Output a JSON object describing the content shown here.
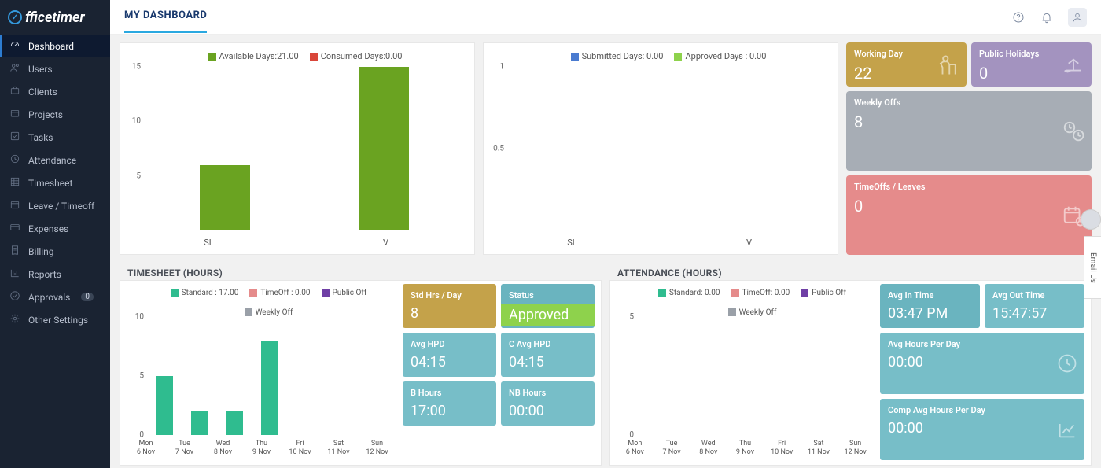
{
  "logo": "fficetimer",
  "page_title": "MY DASHBOARD",
  "sidebar": {
    "items": [
      {
        "icon": "gauge",
        "label": "Dashboard"
      },
      {
        "icon": "users",
        "label": "Users"
      },
      {
        "icon": "briefcase",
        "label": "Clients"
      },
      {
        "icon": "box",
        "label": "Projects"
      },
      {
        "icon": "check-sq",
        "label": "Tasks"
      },
      {
        "icon": "clock",
        "label": "Attendance"
      },
      {
        "icon": "grid",
        "label": "Timesheet"
      },
      {
        "icon": "calendar",
        "label": "Leave / Timeoff"
      },
      {
        "icon": "card",
        "label": "Expenses"
      },
      {
        "icon": "receipt",
        "label": "Billing"
      },
      {
        "icon": "chart",
        "label": "Reports"
      },
      {
        "icon": "check-circle",
        "label": "Approvals",
        "badge": "0"
      },
      {
        "icon": "gear",
        "label": "Other Settings"
      }
    ]
  },
  "chart_data": [
    {
      "type": "bar",
      "title": "",
      "series": [
        {
          "name": "Available Days:21.00",
          "color": "#6aa321"
        },
        {
          "name": "Consumed Days:0.00",
          "color": "#d9463a"
        }
      ],
      "categories": [
        "SL",
        "V"
      ],
      "values": {
        "Available": [
          6,
          15
        ],
        "Consumed": [
          0,
          0
        ]
      },
      "ylim": [
        0,
        15
      ],
      "yticks": [
        5,
        10,
        15
      ]
    },
    {
      "type": "bar",
      "series": [
        {
          "name": "Submitted Days: 0.00",
          "color": "#4a7bd0"
        },
        {
          "name": "Approved Days : 0.00",
          "color": "#8ed24c"
        }
      ],
      "categories": [
        "SL",
        "V"
      ],
      "values": {
        "Submitted": [
          0,
          0
        ],
        "Approved": [
          0,
          0
        ]
      },
      "ylim": [
        0,
        1.0
      ],
      "yticks": [
        0.5,
        1.0
      ]
    },
    {
      "type": "bar",
      "panel": "TIMESHEET (HOURS)",
      "series": [
        {
          "name": "Standard : 17.00",
          "color": "#2fbc8f"
        },
        {
          "name": "TimeOff : 0.00",
          "color": "#e58b8b"
        },
        {
          "name": "Public Off",
          "color": "#6f3fa5"
        },
        {
          "name": "Weekly Off",
          "color": "#9aa0a8"
        }
      ],
      "categories": [
        "Mon 6 Nov",
        "Tue 7 Nov",
        "Wed 8 Nov",
        "Thu 9 Nov",
        "Fri 10 Nov",
        "Sat 11 Nov",
        "Sun 12 Nov"
      ],
      "values": {
        "Standard": [
          5,
          2,
          2,
          8,
          0,
          0,
          0
        ]
      },
      "ylim": [
        0,
        10
      ],
      "yticks": [
        0,
        5,
        10
      ]
    },
    {
      "type": "bar",
      "panel": "ATTENDANCE (HOURS)",
      "series": [
        {
          "name": "Standard: 0.00",
          "color": "#2fbc8f"
        },
        {
          "name": "TimeOff: 0.00",
          "color": "#e58b8b"
        },
        {
          "name": "Public Off",
          "color": "#6f3fa5"
        },
        {
          "name": "Weekly Off",
          "color": "#9aa0a8"
        }
      ],
      "categories": [
        "Mon 6 Nov",
        "Tue 7 Nov",
        "Wed 8 Nov",
        "Thu 9 Nov",
        "Fri 10 Nov",
        "Sat 11 Nov",
        "Sun 12 Nov"
      ],
      "values": {
        "Standard": [
          0,
          0,
          0,
          0,
          0,
          0,
          0
        ]
      },
      "ylim": [
        0,
        5
      ],
      "yticks": [
        0,
        5
      ]
    }
  ],
  "top_kpis": {
    "working_day": {
      "label": "Working Day",
      "val": "22"
    },
    "public_holidays": {
      "label": "Public Holidays",
      "val": "0"
    },
    "weekly_offs": {
      "label": "Weekly Offs",
      "val": "8"
    },
    "timeoffs": {
      "label": "TimeOffs / Leaves",
      "val": "0"
    }
  },
  "timesheet_tiles": {
    "std_hrs": {
      "label": "Std Hrs / Day",
      "val": "8"
    },
    "status": {
      "label": "Status",
      "val": "Approved"
    },
    "avg_hpd": {
      "label": "Avg HPD",
      "val": "04:15"
    },
    "c_avg_hpd": {
      "label": "C Avg HPD",
      "val": "04:15"
    },
    "b_hours": {
      "label": "B Hours",
      "val": "17:00"
    },
    "nb_hours": {
      "label": "NB Hours",
      "val": "00:00"
    }
  },
  "attendance_tiles": {
    "avg_in": {
      "label": "Avg In Time",
      "val": "03:47 PM"
    },
    "avg_out": {
      "label": "Avg Out Time",
      "val": "15:47:57"
    },
    "avg_hpd": {
      "label": "Avg Hours Per Day",
      "val": "00:00"
    },
    "comp_avg": {
      "label": "Comp Avg Hours Per Day",
      "val": "00:00"
    }
  },
  "sections": {
    "timesheet": "TIMESHEET (HOURS)",
    "attendance": "ATTENDANCE (HOURS)"
  },
  "email_tab": "Email Us"
}
